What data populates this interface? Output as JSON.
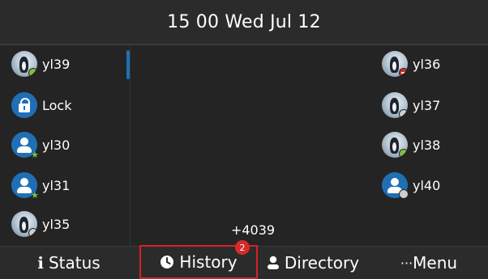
{
  "header": {
    "datetime": "15 00 Wed Jul 12"
  },
  "left_keys": [
    {
      "label": "yl39",
      "avatar": "photo",
      "status": "green"
    },
    {
      "label": "Lock",
      "avatar": "lock-icon",
      "status": "none"
    },
    {
      "label": "yl30",
      "avatar": "person-icon",
      "status": "star-green"
    },
    {
      "label": "yl31",
      "avatar": "person-icon",
      "status": "star-green"
    },
    {
      "label": "yl35",
      "avatar": "photo",
      "status": "gray"
    }
  ],
  "right_keys": [
    {
      "label": "yl36",
      "avatar": "photo",
      "status": "red-busy"
    },
    {
      "label": "yl37",
      "avatar": "photo",
      "status": "gray"
    },
    {
      "label": "yl38",
      "avatar": "photo",
      "status": "green"
    },
    {
      "label": "yl40",
      "avatar": "person-icon",
      "status": "gray"
    }
  ],
  "center": {
    "number": "+4039"
  },
  "softkeys": {
    "status_label": "Status",
    "history_label": "History",
    "history_badge": "2",
    "directory_label": "Directory",
    "menu_label": "Menu",
    "menu_prefix": "···"
  },
  "colors": {
    "accent_blue": "#1f6fb5",
    "highlight_red": "#d9202a",
    "presence_green": "#7bc142",
    "presence_busy": "#d52b2b",
    "presence_offline": "#cfcfcf"
  }
}
